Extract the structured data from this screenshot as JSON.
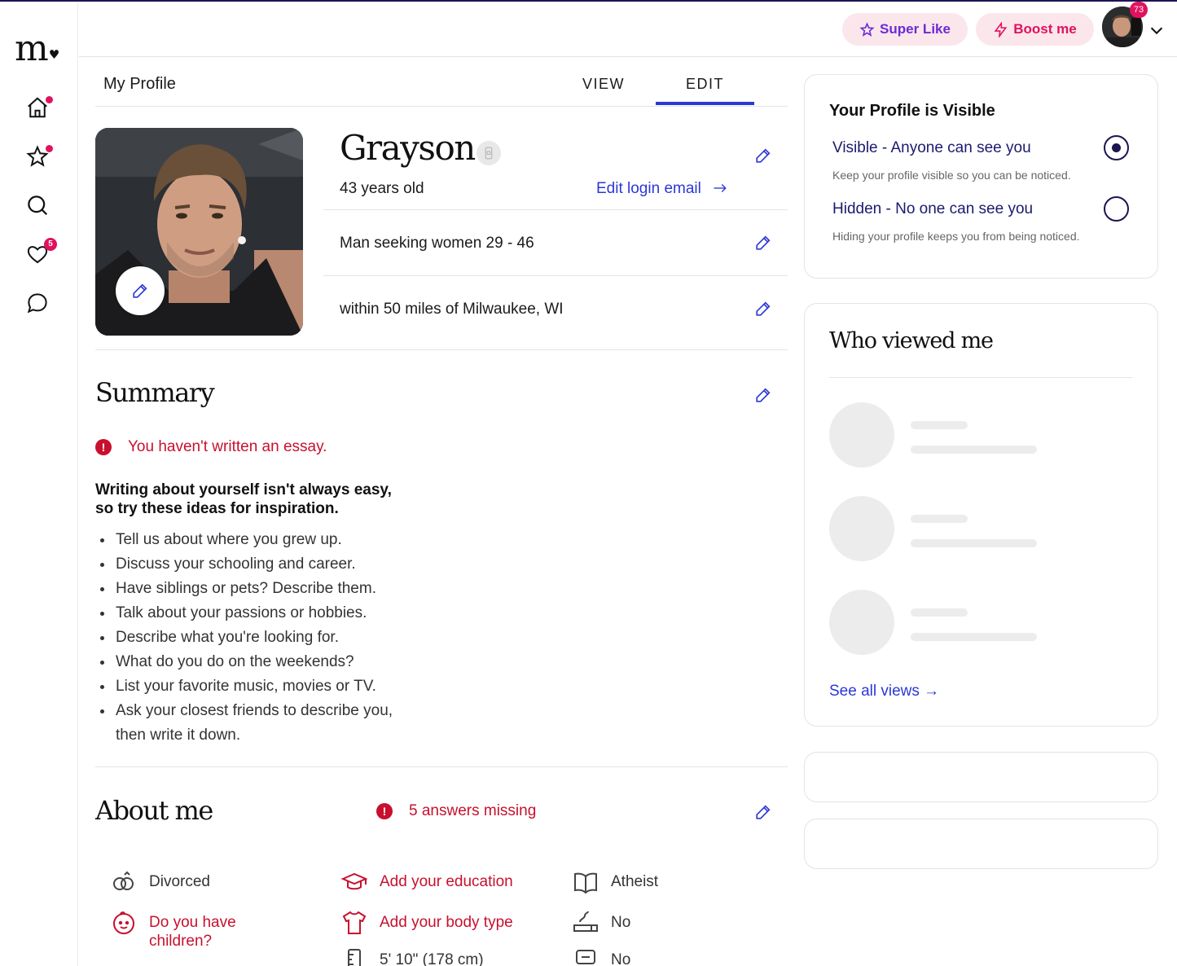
{
  "app": {
    "logo_text": "m.",
    "nav_items": [
      {
        "name": "home",
        "has_dot": true
      },
      {
        "name": "favorites",
        "has_dot": true
      },
      {
        "name": "search",
        "has_dot": false
      },
      {
        "name": "likes",
        "badge": "5"
      },
      {
        "name": "messages",
        "has_dot": false
      }
    ]
  },
  "header": {
    "super_like_label": "Super Like",
    "boost_label": "Boost me",
    "notification_count": "73"
  },
  "profile": {
    "page_title": "My Profile",
    "tabs": [
      {
        "label": "VIEW",
        "active": false
      },
      {
        "label": "EDIT",
        "active": true
      }
    ],
    "name": "Grayson",
    "age": "43 years old",
    "edit_login_email": "Edit login email",
    "seeking": "Man seeking women 29 - 46",
    "location": "within 50 miles of Milwaukee, WI"
  },
  "summary": {
    "title": "Summary",
    "warning": "You haven't written an essay.",
    "ideas_heading_line1": "Writing about yourself isn't always easy,",
    "ideas_heading_line2": "so try these ideas for inspiration.",
    "ideas": [
      "Tell us about where you grew up.",
      "Discuss your schooling and career.",
      "Have siblings or pets? Describe them.",
      "Talk about your passions or hobbies.",
      "Describe what you're looking for.",
      "What do you do on the weekends?",
      "List your favorite music, movies or TV.",
      "Ask your closest friends to describe you, then write it down."
    ]
  },
  "about": {
    "title": "About me",
    "missing": "5 answers missing",
    "items": {
      "marital": "Divorced",
      "children_line1": "Do you have",
      "children_line2": "children?",
      "education": "Add your education",
      "body_type": "Add your body type",
      "height": "5' 10\" (178 cm)",
      "religion": "Atheist",
      "smoking": "No",
      "drinking": "No"
    }
  },
  "visibility": {
    "title": "Your Profile is Visible",
    "visible_label": "Visible - Anyone can see you",
    "visible_sub": "Keep your profile visible so you can be noticed.",
    "hidden_label": "Hidden - No one can see you",
    "hidden_sub": "Hiding your profile keeps you from being noticed.",
    "selected": "visible"
  },
  "who_viewed": {
    "title": "Who viewed me",
    "see_all": "See all views →"
  },
  "colors": {
    "accent_blue": "#2b38d6",
    "brand_pink": "#e0115f",
    "warning_red": "#c8102e",
    "navy": "#1b1553"
  }
}
